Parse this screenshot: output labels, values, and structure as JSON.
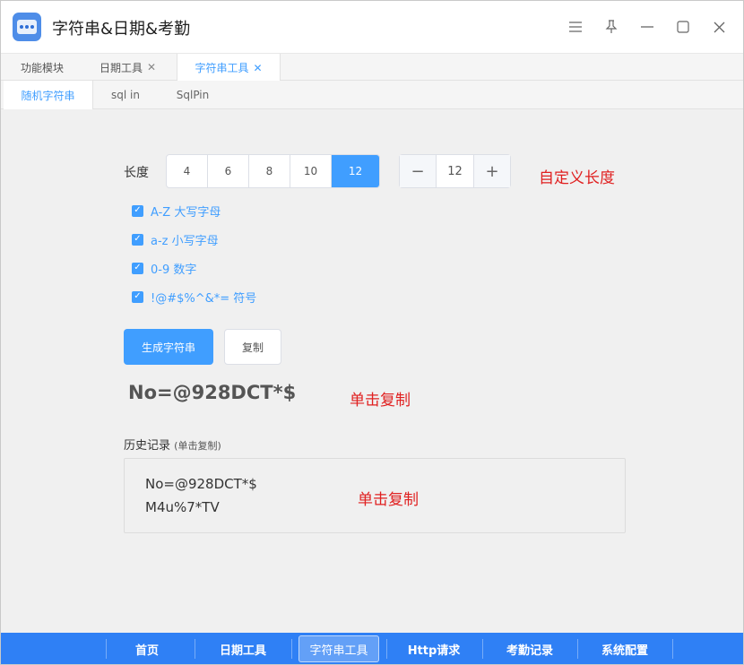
{
  "window": {
    "title": "字符串&日期&考勤",
    "icons": [
      "menu-icon",
      "pin-icon",
      "minimize-icon",
      "maximize-icon",
      "close-icon"
    ]
  },
  "tabs": [
    {
      "label": "功能模块",
      "closable": false
    },
    {
      "label": "日期工具",
      "closable": true
    },
    {
      "label": "字符串工具",
      "closable": true,
      "active": true
    }
  ],
  "subtabs": [
    {
      "label": "随机字符串",
      "active": true
    },
    {
      "label": "sql in"
    },
    {
      "label": "SqlPin"
    }
  ],
  "length": {
    "label": "长度",
    "options": [
      "4",
      "6",
      "8",
      "10",
      "12"
    ],
    "selected": "12",
    "custom_value": "12",
    "annotation": "自定义长度"
  },
  "charsets": [
    {
      "label": "A-Z 大写字母",
      "checked": true
    },
    {
      "label": "a-z 小写字母",
      "checked": true
    },
    {
      "label": "0-9 数字",
      "checked": true
    },
    {
      "label": "!@#$%^&*= 符号",
      "checked": true
    }
  ],
  "actions": {
    "generate": "生成字符串",
    "copy": "复制"
  },
  "result": {
    "value": "No=@928DCT*$",
    "annotation": "单击复制"
  },
  "history": {
    "title": "历史记录",
    "hint": "(单击复制)",
    "items": [
      "No=@928DCT*$",
      "M4u%7*TV"
    ],
    "annotation": "单击复制"
  },
  "bottom_nav": [
    {
      "label": "首页"
    },
    {
      "label": "日期工具"
    },
    {
      "label": "字符串工具",
      "active": true
    },
    {
      "label": "Http请求"
    },
    {
      "label": "考勤记录"
    },
    {
      "label": "系统配置"
    }
  ],
  "colors": {
    "accent": "#409eff",
    "annotation": "#e02020",
    "bottom_bar": "#2f80f5"
  }
}
